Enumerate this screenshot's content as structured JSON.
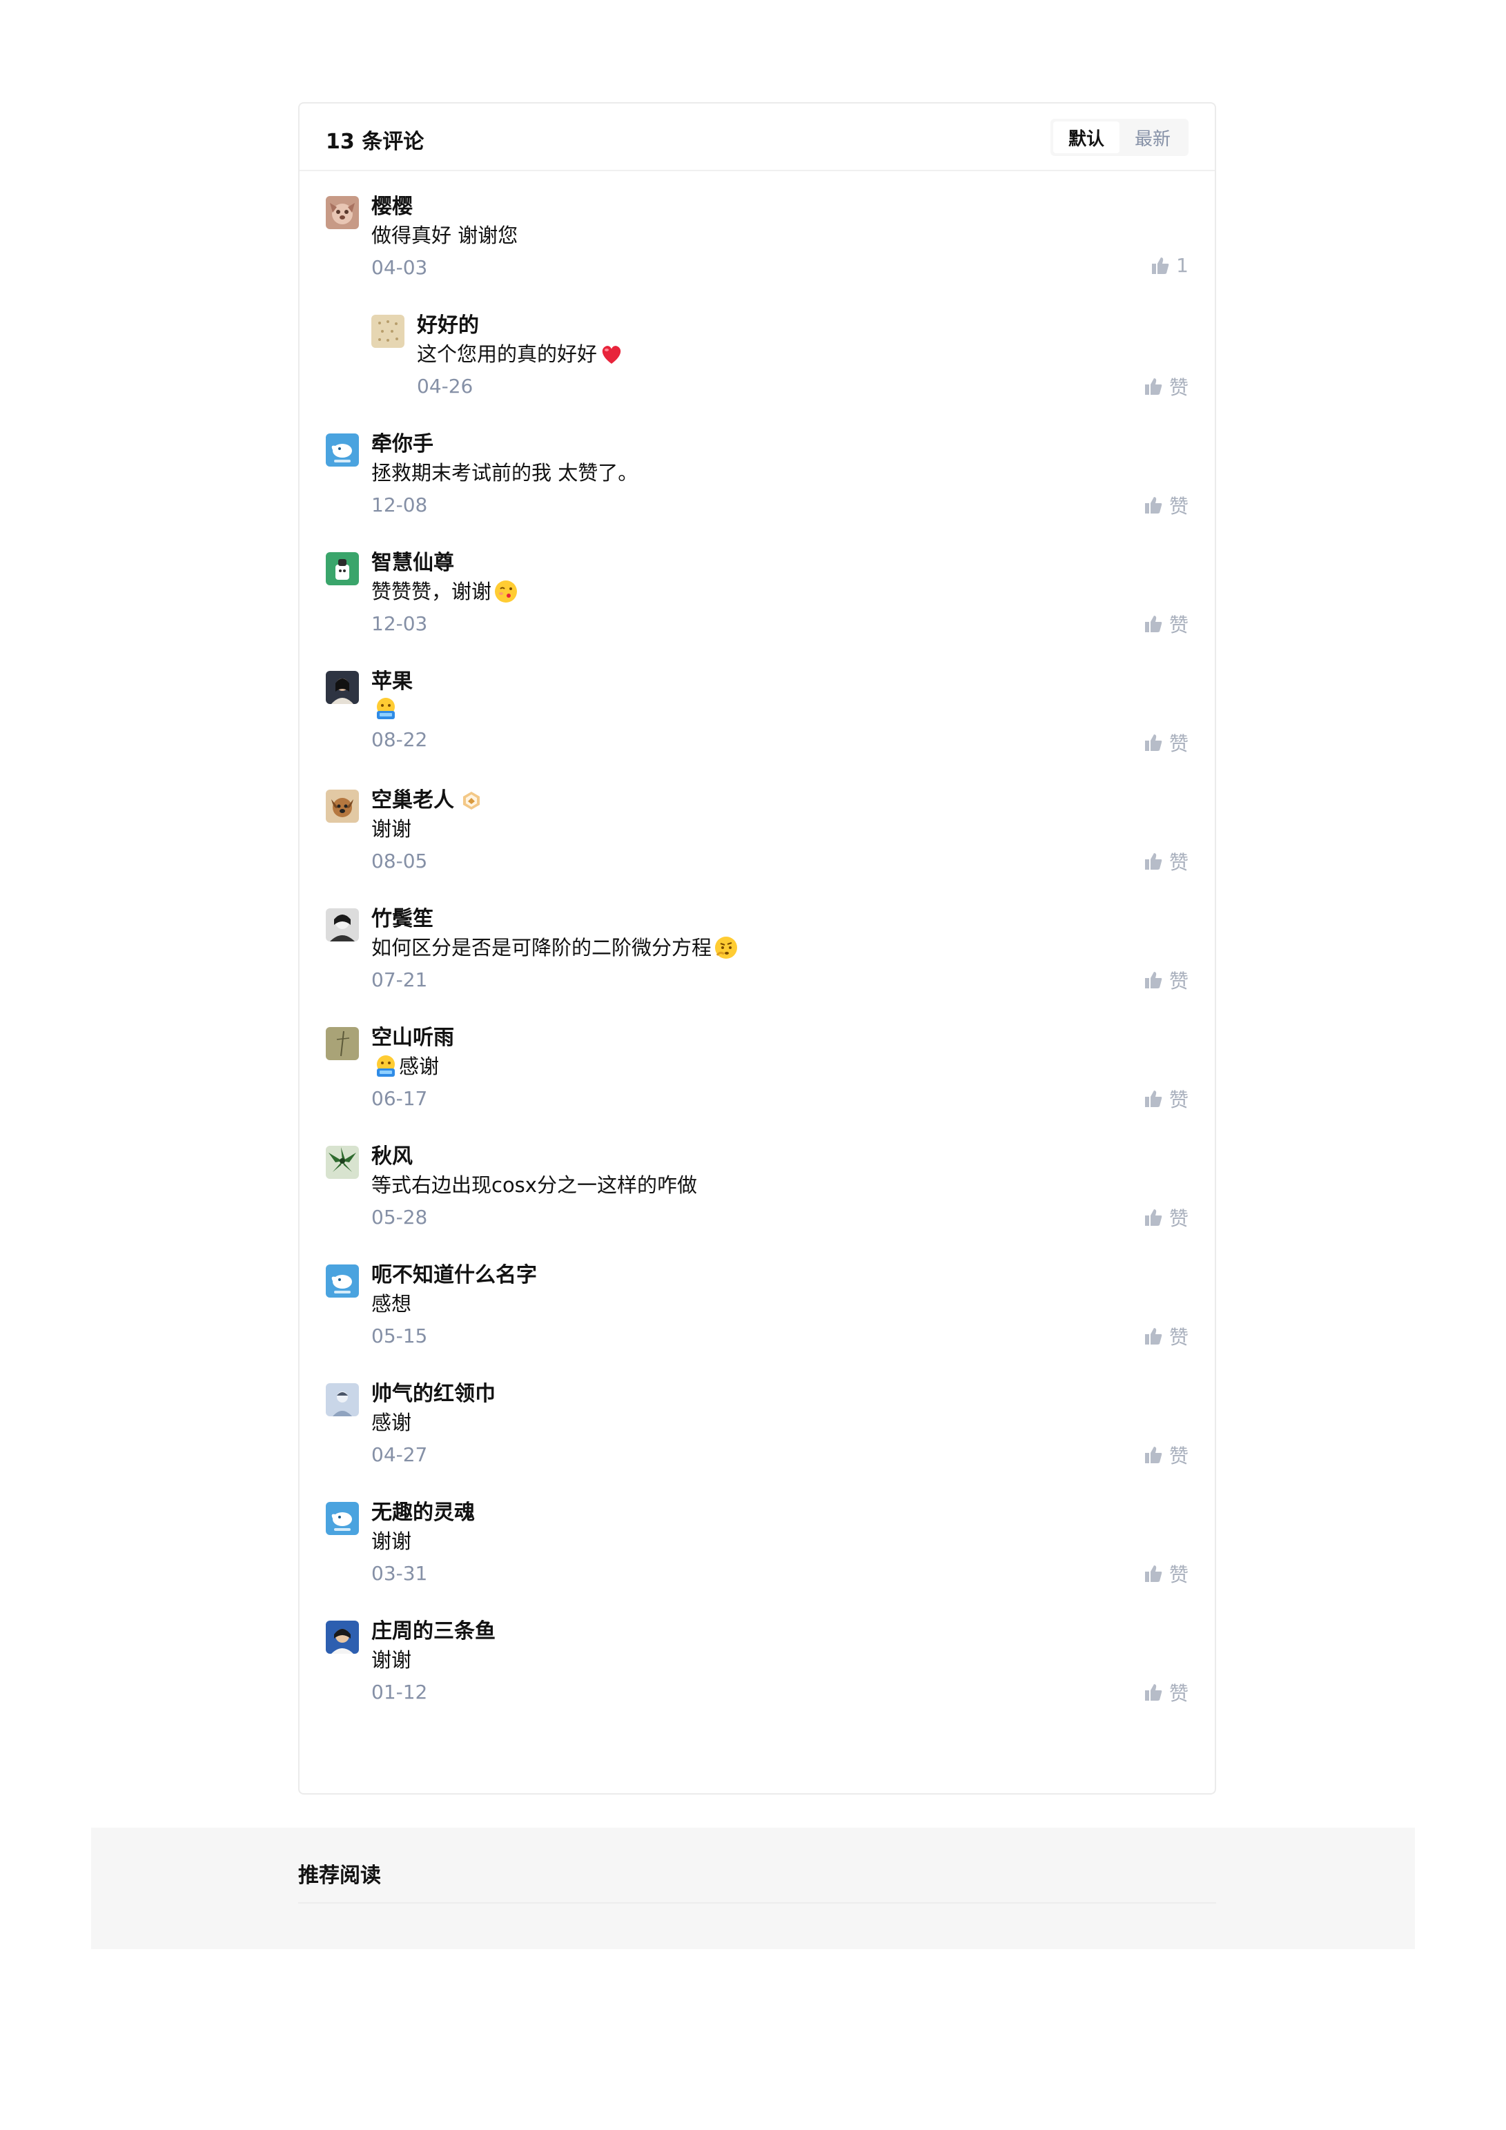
{
  "comments_section": {
    "count_title": "13 条评论",
    "sort_tabs": [
      {
        "label": "默认",
        "active": true
      },
      {
        "label": "最新",
        "active": false
      }
    ]
  },
  "comments": [
    {
      "name": "樱樱",
      "text": "做得真好 谢谢您",
      "date": "04-03",
      "like": "1",
      "avatar": "photo-dog-avatar",
      "reply": false
    },
    {
      "name": "好好的",
      "text": "这个您用的真的好好",
      "emoji": "red-heart",
      "date": "04-26",
      "like": "赞",
      "avatar": "beige-pattern-avatar",
      "reply": true
    },
    {
      "name": "牵你手",
      "text": "拯救期末考试前的我 太赞了。",
      "date": "12-08",
      "like": "赞",
      "avatar": "zhihu-default-avatar",
      "reply": false
    },
    {
      "name": "智慧仙尊",
      "text": "赞赞赞，谢谢",
      "emoji": "kiss-wink-emoji",
      "date": "12-03",
      "like": "赞",
      "avatar": "green-character-avatar",
      "reply": false
    },
    {
      "name": "苹果",
      "text": "",
      "emoji": "zan-tong-emoji",
      "date": "08-22",
      "like": "赞",
      "avatar": "portrait-avatar",
      "reply": false
    },
    {
      "name": "空巢老人",
      "text": "谢谢",
      "date": "08-05",
      "like": "赞",
      "avatar": "dog-photo-avatar",
      "reply": false,
      "badge": "level-badge"
    },
    {
      "name": "竹鬓笙",
      "text": "如何区分是否是可降阶的二阶微分方程",
      "emoji": "thinking-emoji",
      "date": "07-21",
      "like": "赞",
      "avatar": "bw-portrait-avatar",
      "reply": false
    },
    {
      "name": "空山听雨",
      "text": "感谢",
      "emoji_prefix": "zan-tong-emoji",
      "date": "06-17",
      "like": "赞",
      "avatar": "olive-sketch-avatar",
      "reply": false
    },
    {
      "name": "秋风",
      "text": "等式右边出现cosx分之一这样的咋做",
      "date": "05-28",
      "like": "赞",
      "avatar": "palm-tree-avatar",
      "reply": false
    },
    {
      "name": "呃不知道什么名字",
      "text": "感想",
      "date": "05-15",
      "like": "赞",
      "avatar": "zhihu-default-avatar",
      "reply": false
    },
    {
      "name": "帅气的红领巾",
      "text": "感谢",
      "date": "04-27",
      "like": "赞",
      "avatar": "pale-photo-avatar",
      "reply": false
    },
    {
      "name": "无趣的灵魂",
      "text": "谢谢",
      "date": "03-31",
      "like": "赞",
      "avatar": "zhihu-default-avatar",
      "reply": false
    },
    {
      "name": "庄周的三条鱼",
      "text": "谢谢",
      "date": "01-12",
      "like": "赞",
      "avatar": "blue-portrait-avatar",
      "reply": false
    }
  ],
  "recommend": {
    "title": "推荐阅读"
  },
  "colors": {
    "text_primary": "#121212",
    "text_secondary": "#8590a6",
    "like_icon": "#a9b0bd",
    "border": "#ebebeb",
    "recommend_bg": "#f6f6f6"
  }
}
